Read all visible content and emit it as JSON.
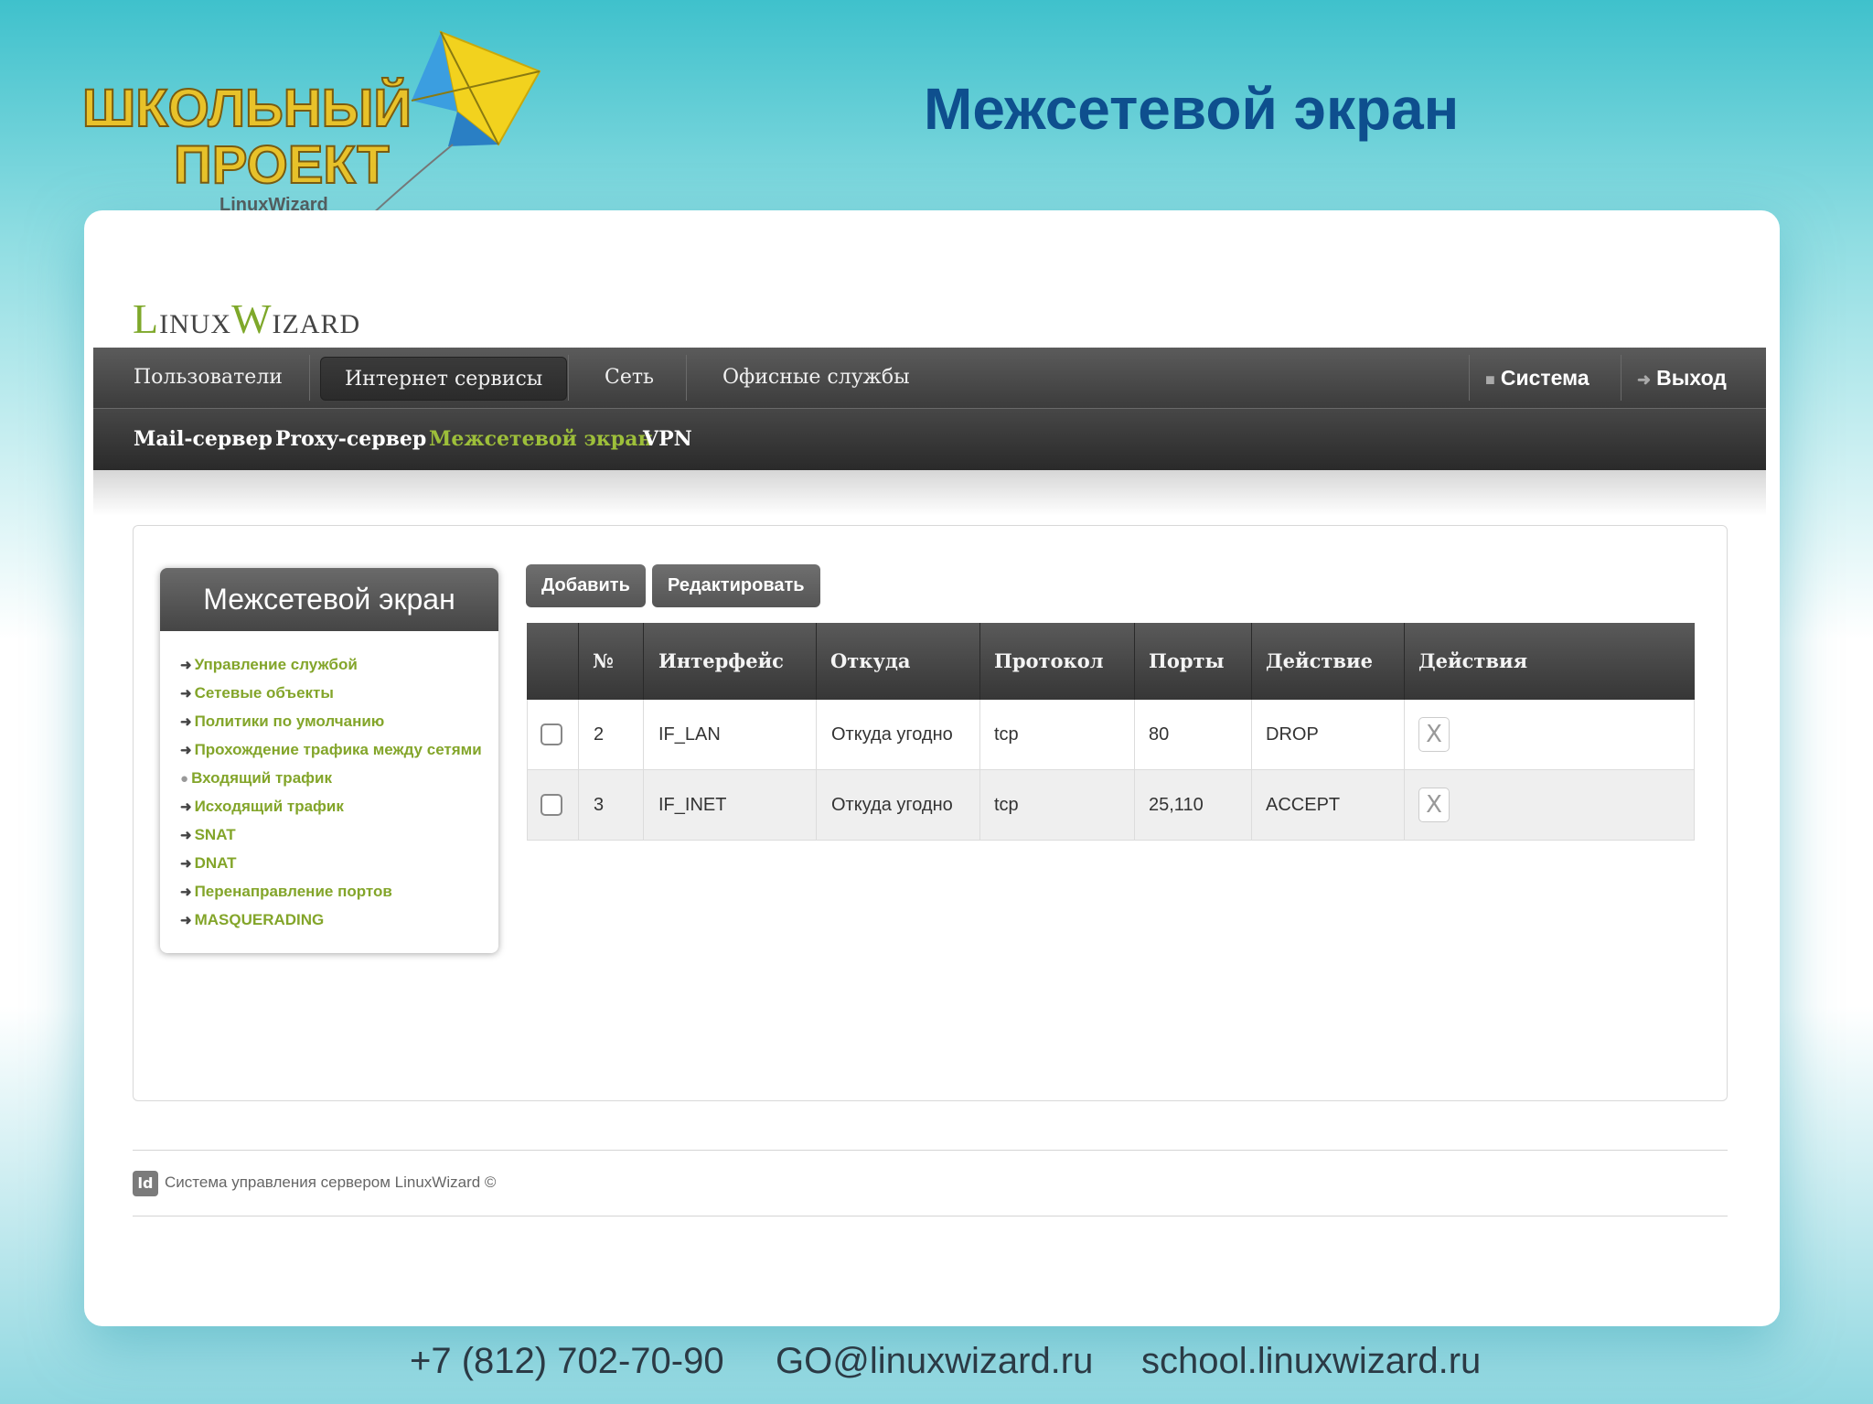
{
  "slide": {
    "title": "Межсетевой экран",
    "school_logo_line1": "ШКОЛЬНЫЙ",
    "school_logo_line2": "ПРОЕКТ",
    "school_logo_sub": "LinuxWizard"
  },
  "brand": {
    "first_letter": "L",
    "part1": "INUX",
    "second_letter": "W",
    "part2": "IZARD",
    "accent_color": "#7ea82a"
  },
  "nav": {
    "items": [
      "Пользователи",
      "Интернет сервисы",
      "Сеть",
      "Офисные службы"
    ],
    "active_index": 1,
    "system": "Система",
    "logout": "Выход"
  },
  "subnav": {
    "items": [
      "Mail-сервер",
      "Proxy-сервер",
      "Межсетевой экран",
      "VPN"
    ],
    "active_index": 2
  },
  "sidebar": {
    "title": "Межсетевой экран",
    "items": [
      "Управление службой",
      "Сетевые объекты",
      "Политики по умолчанию",
      "Прохождение трафика между сетями",
      "Входящий трафик",
      "Исходящий трафик",
      "SNAT",
      "DNAT",
      "Перенаправление портов",
      "MASQUERADING"
    ],
    "current_index": 4
  },
  "toolbar": {
    "add_label": "Добавить",
    "edit_label": "Редактировать"
  },
  "table": {
    "headers": [
      "№",
      "Интерфейс",
      "Откуда",
      "Протокол",
      "Порты",
      "Действие",
      "Действия"
    ],
    "rows": [
      {
        "num": "2",
        "iface": "IF_LAN",
        "from": "Откуда угодно",
        "proto": "tcp",
        "ports": "80",
        "action": "DROP",
        "delete": "X",
        "checked": false
      },
      {
        "num": "3",
        "iface": "IF_INET",
        "from": "Откуда угодно",
        "proto": "tcp",
        "ports": "25,110",
        "action": "ACCEPT",
        "delete": "X",
        "checked": false
      }
    ]
  },
  "footer": {
    "icon_text": "ld",
    "text": "Система управления сервером LinuxWizard ©"
  },
  "contacts": {
    "phone": "+7 (812) 702-70-90",
    "email": "GO@linuxwizard.ru",
    "site": "school.linuxwizard.ru"
  }
}
